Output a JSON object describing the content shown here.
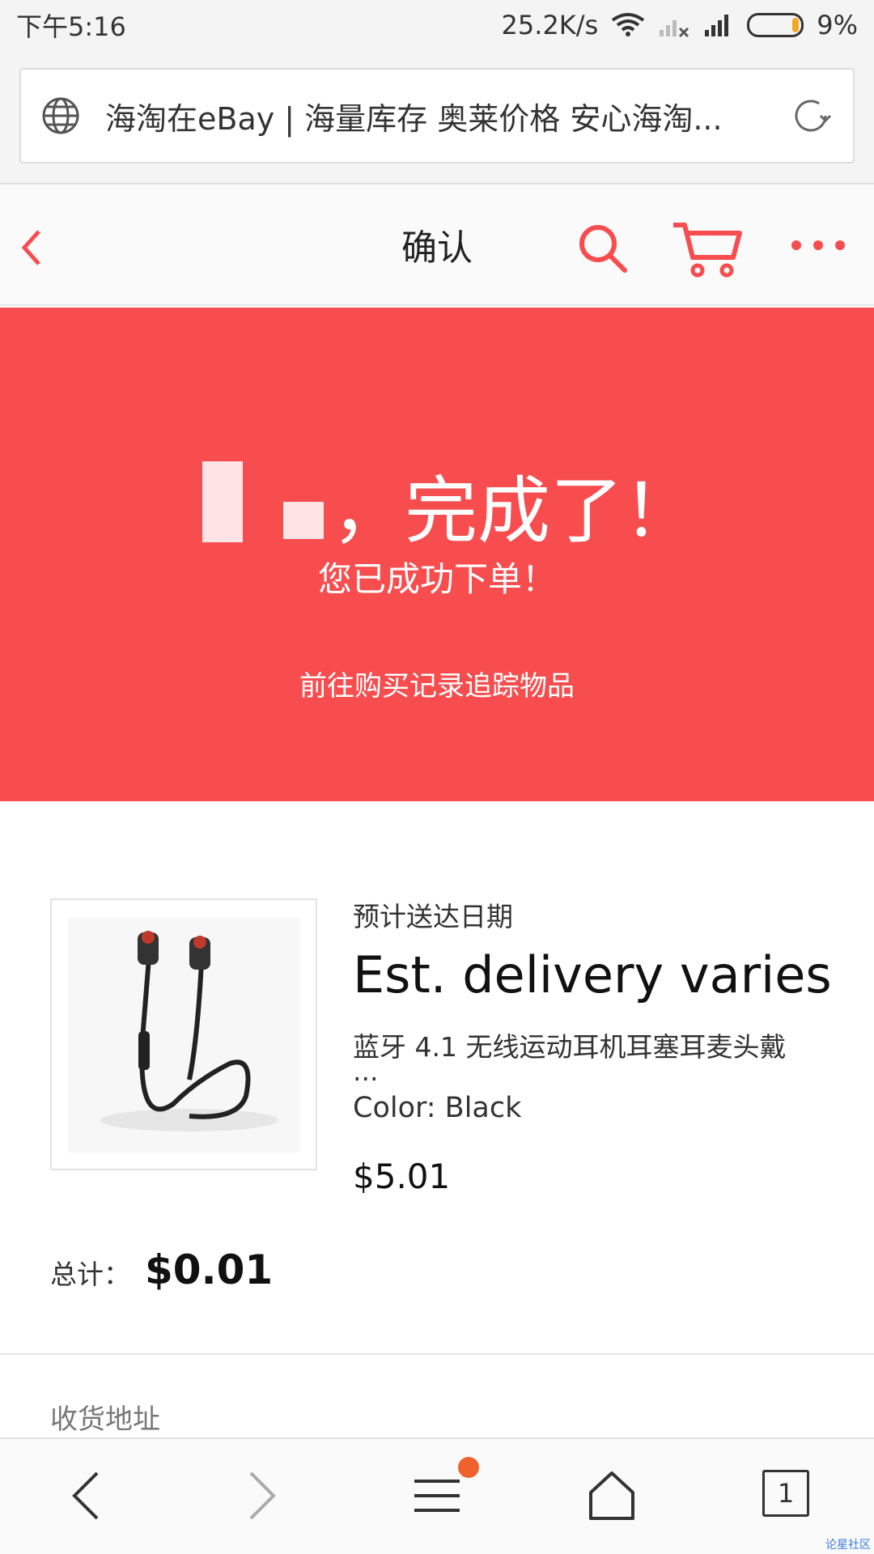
{
  "status": {
    "time": "下午5:16",
    "speed": "25.2K/s",
    "battery": "9%"
  },
  "browser": {
    "page_title": "海淘在eBay | 海量库存 奥莱价格 安心海淘..."
  },
  "header": {
    "title": "确认"
  },
  "banner": {
    "headline": "，完成了！",
    "subtitle": "您已成功下单！",
    "track_link": "前往购买记录追踪物品"
  },
  "item": {
    "delivery_label": "预计送达日期",
    "delivery_value": "Est. delivery varies",
    "name": "蓝牙 4.1 无线运动耳机耳塞耳麦头戴",
    "name_ellipsis": "...",
    "color": "Color: Black",
    "price": "$5.01"
  },
  "total": {
    "label": "总计：",
    "value": "$0.01"
  },
  "address": {
    "label": "收货地址"
  },
  "toolbar": {
    "tab_count": "1"
  },
  "watermark": "论星社区",
  "colors": {
    "brand_red": "#f74d4f",
    "notify_dot": "#f0622d"
  }
}
